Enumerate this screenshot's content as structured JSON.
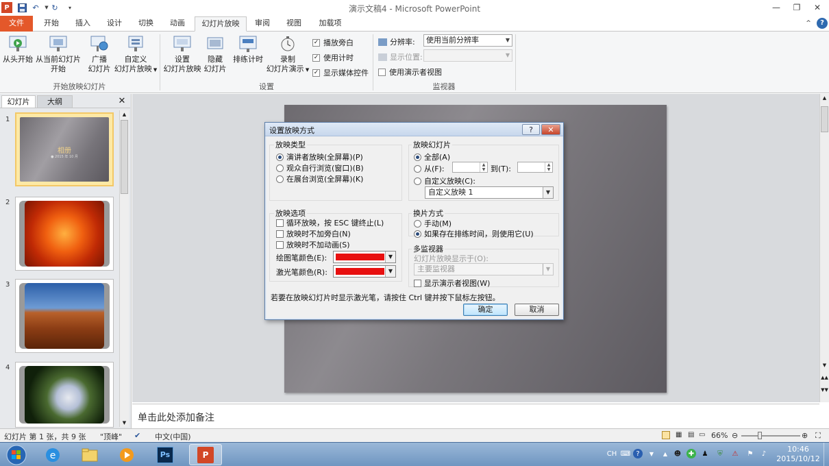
{
  "window": {
    "title": "演示文稿4 - Microsoft PowerPoint"
  },
  "tabs": [
    {
      "label": "文件"
    },
    {
      "label": "开始"
    },
    {
      "label": "插入"
    },
    {
      "label": "设计"
    },
    {
      "label": "切换"
    },
    {
      "label": "动画"
    },
    {
      "label": "幻灯片放映"
    },
    {
      "label": "审阅"
    },
    {
      "label": "视图"
    },
    {
      "label": "加载项"
    }
  ],
  "ribbon": {
    "group_start": {
      "label": "开始放映幻灯片",
      "from_beginning": "从头开始",
      "from_current_l1": "从当前幻灯片",
      "from_current_l2": "开始",
      "broadcast_l1": "广播",
      "broadcast_l2": "幻灯片",
      "custom_l1": "自定义",
      "custom_l2": "幻灯片放映"
    },
    "group_setup": {
      "label": "设置",
      "setup_l1": "设置",
      "setup_l2": "幻灯片放映",
      "hide_l1": "隐藏",
      "hide_l2": "幻灯片",
      "rehearse": "排练计时",
      "record_l1": "录制",
      "record_l2": "幻灯片演示",
      "play_narrations": "播放旁白",
      "use_timings": "使用计时",
      "show_media": "显示媒体控件"
    },
    "group_monitors": {
      "label": "监视器",
      "resolution_label": "分辨率:",
      "resolution_value": "使用当前分辨率",
      "show_on_label": "显示位置:",
      "presenter_view": "使用演示者视图"
    }
  },
  "left_pane": {
    "tab_slides": "幻灯片",
    "tab_outline": "大纲",
    "slides": [
      {
        "num": "1",
        "title": "相册",
        "subtitle": "● 2015 年 10 月"
      },
      {
        "num": "2"
      },
      {
        "num": "3"
      },
      {
        "num": "4"
      }
    ]
  },
  "notes": {
    "placeholder": "单击此处添加备注"
  },
  "status": {
    "slide_info": "幻灯片 第 1 张，共 9 张",
    "theme": "\"顶峰\"",
    "language": "中文(中国)",
    "zoom": "66%"
  },
  "taskbar": {
    "ime": "CH",
    "time": "10:46",
    "date": "2015/10/12"
  },
  "dialog": {
    "title": "设置放映方式",
    "help": "?",
    "show_type": {
      "title": "放映类型",
      "options": [
        "演讲者放映(全屏幕)(P)",
        "观众自行浏览(窗口)(B)",
        "在展台浏览(全屏幕)(K)"
      ]
    },
    "slides": {
      "title": "放映幻灯片",
      "all": "全部(A)",
      "from": "从(F):",
      "to": "到(T):",
      "custom": "自定义放映(C):",
      "custom_value": "自定义放映 1"
    },
    "show_options": {
      "title": "放映选项",
      "loop": "循环放映，按 ESC 键终止(L)",
      "no_narration": "放映时不加旁白(N)",
      "no_animation": "放映时不加动画(S)",
      "pen_color": "绘图笔颜色(E):",
      "laser_color": "激光笔颜色(R):"
    },
    "advance": {
      "title": "换片方式",
      "manual": "手动(M)",
      "use_timings": "如果存在排练时间，则使用它(U)"
    },
    "multi_monitor": {
      "title": "多监视器",
      "display_on": "幻灯片放映显示于(O):",
      "monitor_value": "主要监视器",
      "presenter_view": "显示演示者视图(W)"
    },
    "hint": "若要在放映幻灯片时显示激光笔，请按住 Ctrl 键并按下鼠标左按钮。",
    "ok": "确定",
    "cancel": "取消"
  },
  "colors": {
    "file_tab": "#e4582a",
    "pen_red": "#e81010"
  }
}
